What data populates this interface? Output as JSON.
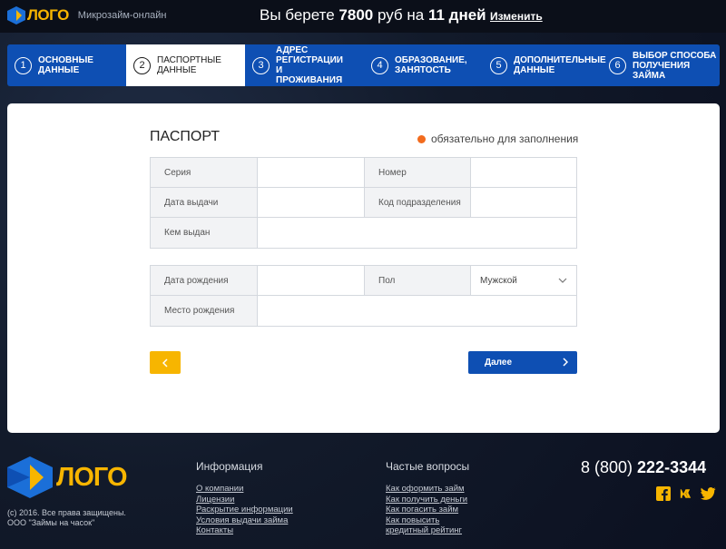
{
  "header": {
    "logo_text": "ЛОГО",
    "tagline": "Микрозайм-онлайн",
    "offer_prefix": "Вы берете ",
    "offer_amount": "7800",
    "offer_mid": " руб на ",
    "offer_days": "11 дней",
    "change_link": "Изменить"
  },
  "steps": [
    {
      "num": "1",
      "label": "ОСНОВНЫЕ ДАННЫЕ",
      "active": false
    },
    {
      "num": "2",
      "label": "ПАСПОРТНЫЕ ДАННЫЕ",
      "active": true
    },
    {
      "num": "3",
      "label": "АДРЕС РЕГИСТРАЦИИ И ПРОЖИВАНИЯ",
      "active": false
    },
    {
      "num": "4",
      "label": "ОБРАЗОВАНИЕ, ЗАНЯТОСТЬ",
      "active": false
    },
    {
      "num": "5",
      "label": "ДОПОЛНИТЕЛЬНЫЕ ДАННЫЕ",
      "active": false
    },
    {
      "num": "6",
      "label": "ВЫБОР СПОСОБА ПОЛУЧЕНИЯ ЗАЙМА",
      "active": false
    }
  ],
  "form": {
    "title": "ПАСПОРТ",
    "required_note": "обязательно для заполнения",
    "series_label": "Серия",
    "series_value": "",
    "number_label": "Номер",
    "number_value": "",
    "issue_date_label": "Дата выдачи",
    "issue_date_value": "",
    "dept_code_label": "Код подразделения",
    "dept_code_value": "",
    "issued_by_label": "Кем выдан",
    "issued_by_value": "",
    "birth_date_label": "Дата рождения",
    "birth_date_value": "",
    "gender_label": "Пол",
    "gender_value": "Мужской",
    "birth_place_label": "Место рождения",
    "birth_place_value": "",
    "next_button": "Далее"
  },
  "footer": {
    "logo_text": "ЛОГО",
    "copyright_1": "(c) 2016. Все права защищены.",
    "copyright_2": "ООО \"Займы на часок\"",
    "info_title": "Информация",
    "info_links": [
      "О компании",
      "Лицензии",
      "Раскрытие информации",
      "Условия выдачи займа",
      "Контакты"
    ],
    "faq_title": "Частые вопросы",
    "faq_links": [
      "Как оформить займ",
      "Как получить деньги",
      "Как погасить займ",
      "Как повысить",
      "кредитный рейтинг"
    ],
    "phone_prefix": "8 (800) ",
    "phone_number": "222-3344",
    "socials": [
      "facebook-icon",
      "vk-icon",
      "twitter-icon"
    ]
  },
  "colors": {
    "accent_blue": "#0e4fb3",
    "accent_yellow": "#f7b500",
    "required_dot": "#f26b1d"
  }
}
